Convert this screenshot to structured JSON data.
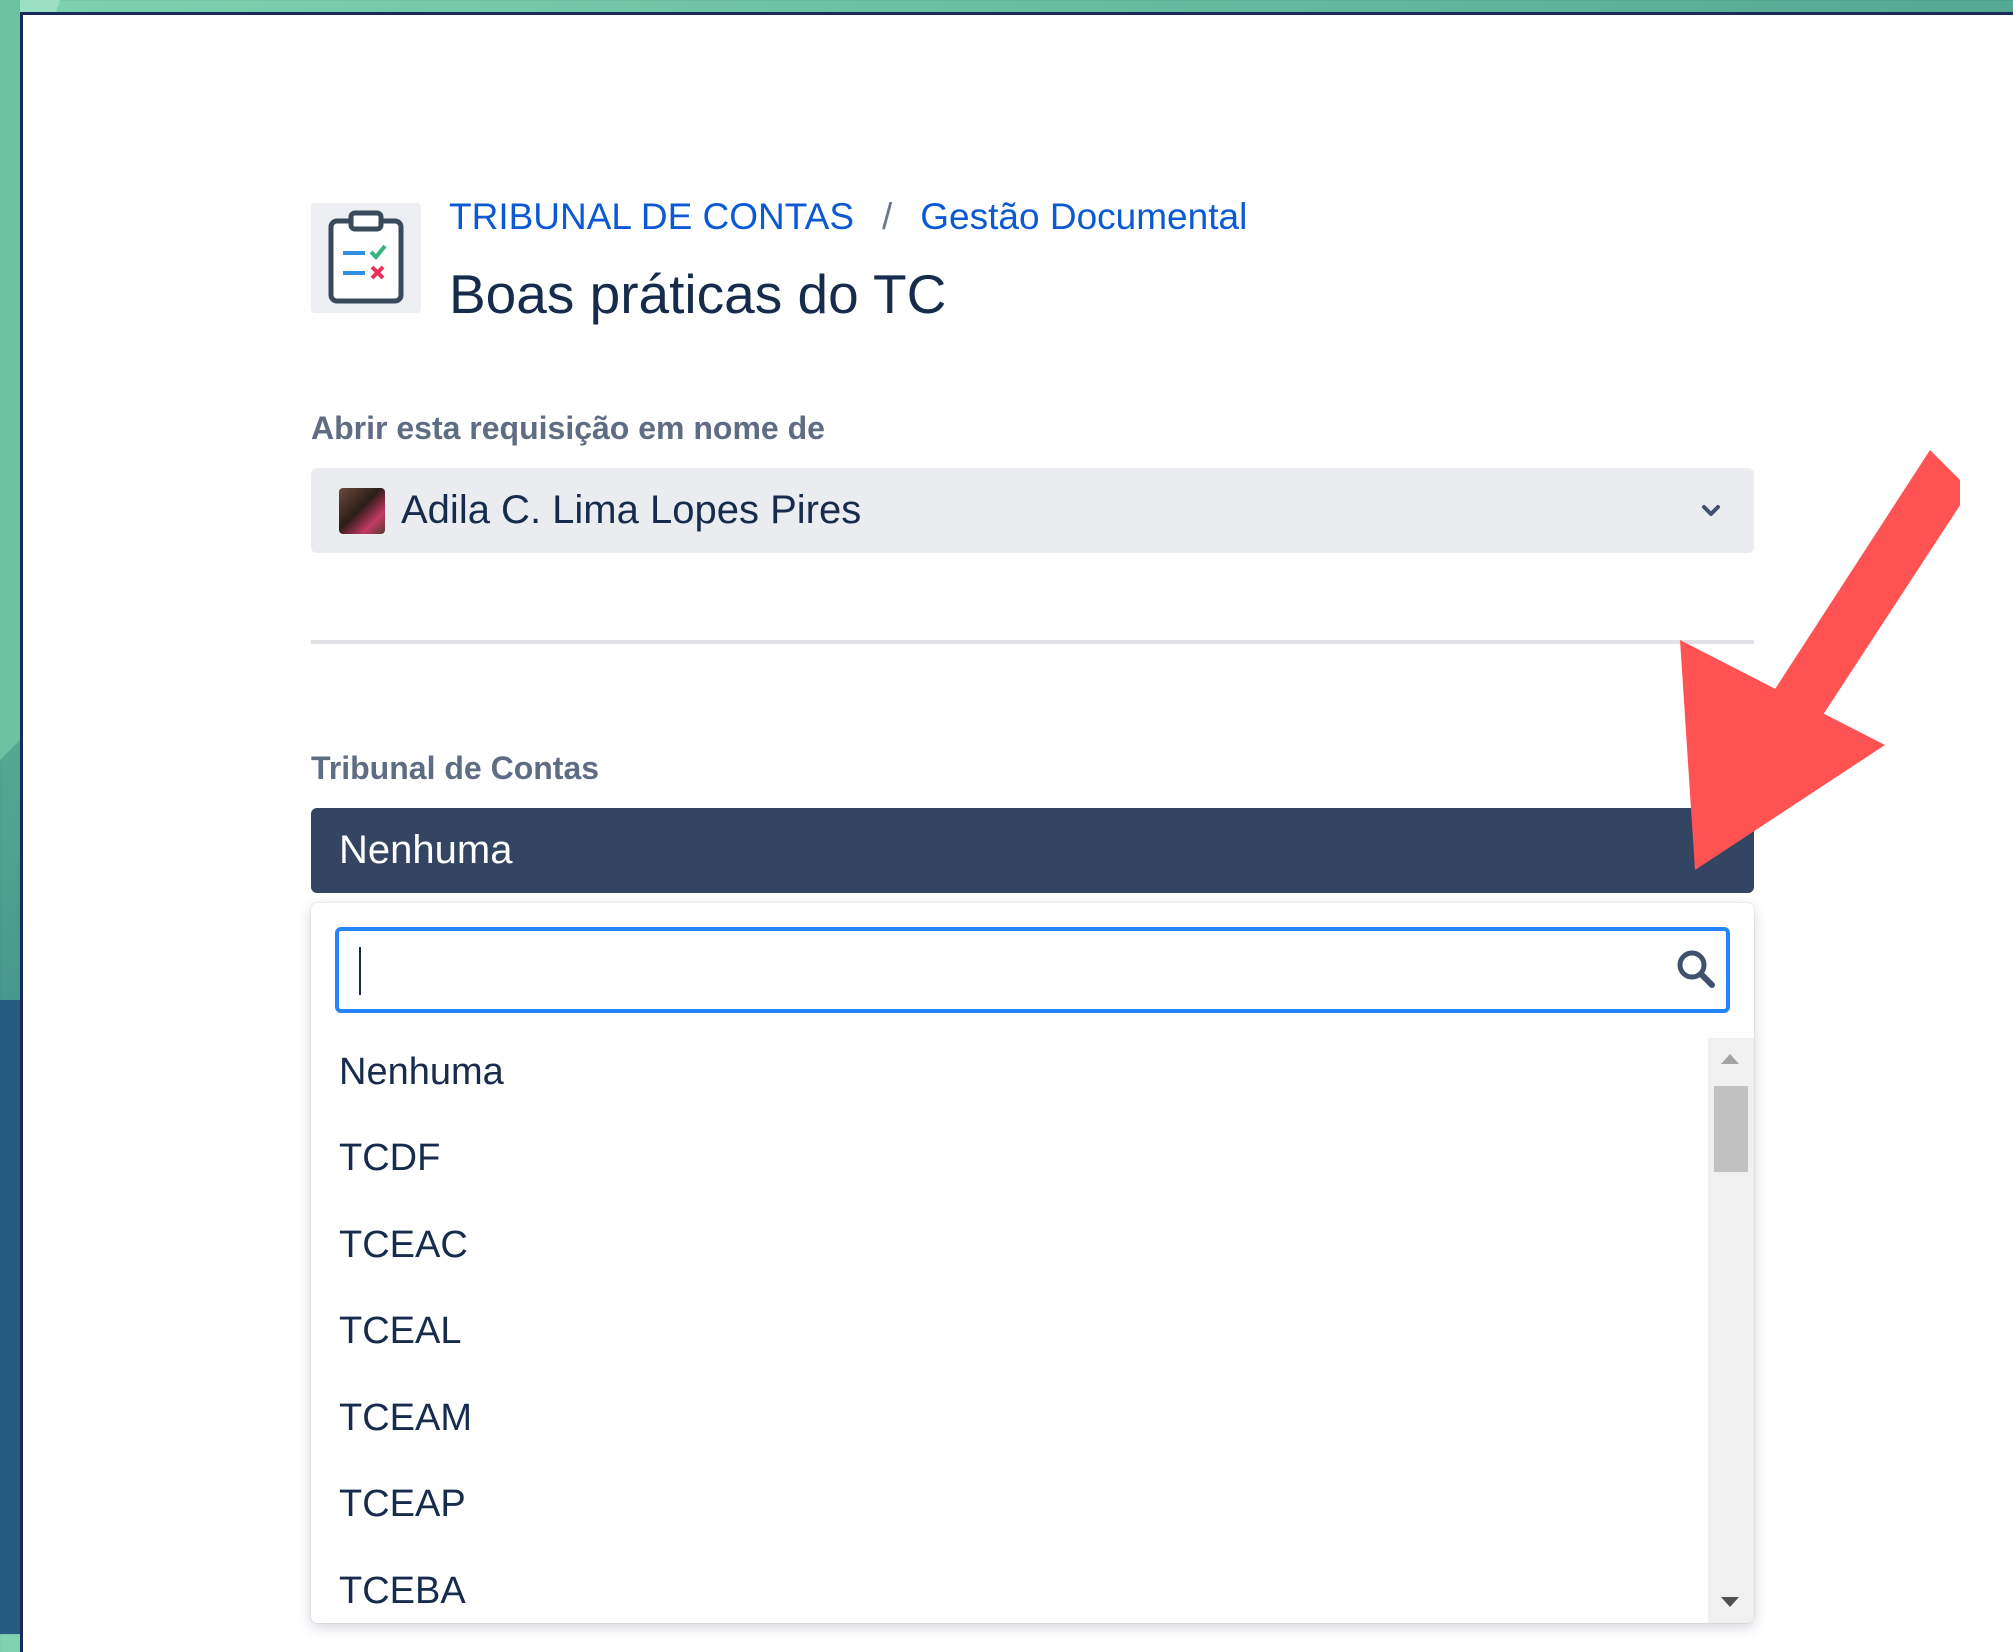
{
  "header": {
    "breadcrumb": [
      "TRIBUNAL DE CONTAS",
      "Gestão Documental"
    ],
    "breadcrumb_separator": "/",
    "title": "Boas práticas do TC"
  },
  "form": {
    "requester_label": "Abrir esta requisição em nome de",
    "requester_value": "Adila C. Lima Lopes Pires",
    "tribunal_label": "Tribunal de Contas",
    "tribunal_value": "Nenhuma"
  },
  "dropdown": {
    "search_value": "",
    "options": [
      "Nenhuma",
      "TCDF",
      "TCEAC",
      "TCEAL",
      "TCEAM",
      "TCEAP",
      "TCEBA"
    ]
  },
  "colors": {
    "link": "#0c5ad3",
    "selected_bg": "#344563",
    "focus_border": "#2684ff",
    "annotation_arrow": "#ff5252"
  }
}
